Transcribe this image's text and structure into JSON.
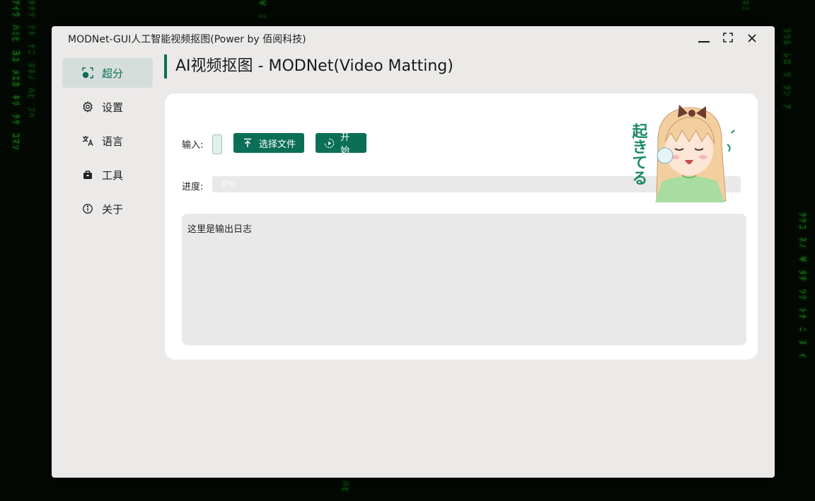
{
  "window": {
    "title": "MODNet-GUI人工智能视频抠图(Power by 佰阅科技)",
    "controls": {
      "minimize": "—",
      "maximize": "⛶",
      "close": "✕"
    }
  },
  "sidebar": {
    "items": [
      {
        "label": "超分",
        "icon": "image-enhance-icon",
        "active": true
      },
      {
        "label": "设置",
        "icon": "gear-icon",
        "active": false
      },
      {
        "label": "语言",
        "icon": "translate-icon",
        "active": false
      },
      {
        "label": "工具",
        "icon": "toolbox-icon",
        "active": false
      },
      {
        "label": "关于",
        "icon": "info-icon",
        "active": false
      }
    ]
  },
  "page": {
    "title": "AI视频抠图 - MODNet(Video Matting)"
  },
  "form": {
    "input_label": "输入:",
    "select_file_label": "选择文件",
    "start_label": "开始",
    "progress_label": "进度:",
    "progress_text": "0%",
    "progress_value": 0
  },
  "log": {
    "text": "这里是输出日志"
  },
  "sticker": {
    "text": "起きてる"
  },
  "colors": {
    "accent": "#0b6f57",
    "window_bg": "#ebeae9",
    "card_bg": "#ffffff"
  }
}
